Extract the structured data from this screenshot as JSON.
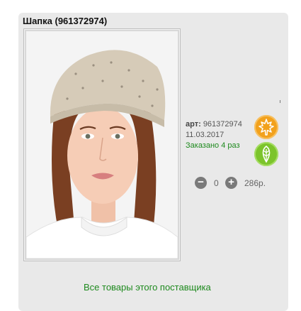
{
  "product": {
    "title": "Шапка (961372974)",
    "article_label": "арт:",
    "article_number": "961372974",
    "date": "11.03.2017",
    "ordered_text": "Заказано 4 раз",
    "image_alt": "beige beanie hat worn by model"
  },
  "cart": {
    "minus_symbol": "−",
    "quantity": "0",
    "plus_symbol": "+",
    "price": "286р."
  },
  "icons": {
    "season_icon": "maple-leaf-icon",
    "season_color": "#f2a11c",
    "eco_icon": "leaf-icon",
    "eco_color": "#7cc42b"
  },
  "footer": {
    "supplier_link": "Все товары этого поставщика"
  }
}
